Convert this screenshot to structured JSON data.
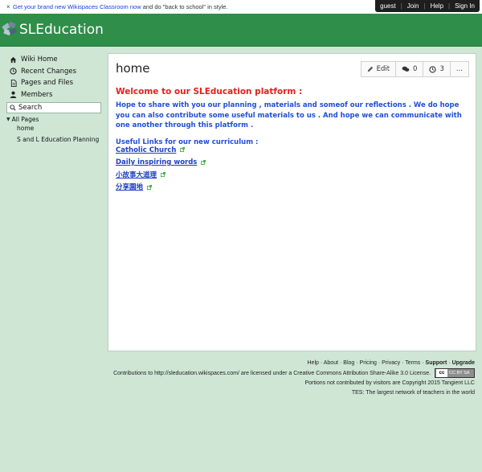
{
  "notice": {
    "close_glyph": "×",
    "link_text": "Get your brand new Wikispaces Classroom now",
    "rest_text": " and do \"back to school\" in style."
  },
  "userbar": {
    "items": [
      "guest",
      "Join",
      "Help",
      "Sign In"
    ]
  },
  "header": {
    "site_title": "SLEducation"
  },
  "sidebar": {
    "items": [
      {
        "label": "Wiki Home",
        "icon": "home-icon"
      },
      {
        "label": "Recent Changes",
        "icon": "clock-icon"
      },
      {
        "label": "Pages and Files",
        "icon": "file-icon"
      },
      {
        "label": "Members",
        "icon": "user-icon"
      }
    ],
    "search_placeholder": "Search",
    "all_pages_label": "All Pages",
    "pages": [
      "home",
      "S and L Education Planning"
    ]
  },
  "main": {
    "page_title": "home",
    "toolbar": {
      "edit_label": "Edit",
      "comments_count": "0",
      "history_count": "3",
      "more_label": "..."
    },
    "welcome": "Welcome to our SLEducation platform :",
    "paragraph": "Hope to share with you our planning , materials and someof our reflections . We do hope you can also contribute some useful materials to us . And hope we can communicate with one another through this platform .",
    "useful_heading": "Useful Links for our new curriculum :",
    "links": [
      "Catholic Church",
      "Daily inspiring words",
      "小故事大道理",
      "分享園地"
    ]
  },
  "footer": {
    "links": [
      "Help",
      "About",
      "Blog",
      "Pricing",
      "Privacy",
      "Terms",
      "Support",
      "Upgrade"
    ],
    "license_text": "Contributions to http://sleducation.wikispaces.com/ are licensed under a Creative Commons Attribution Share-Alike 3.0 License.",
    "cc_badge_text": "CC BY SA",
    "copyright": "Portions not contributed by visitors are Copyright 2015 Tangient LLC",
    "tes": "TES: The largest network of teachers in the world"
  },
  "colors": {
    "background": "#cfe6d5",
    "header_green": "#2f8e4a",
    "welcome_red": "#e4201e",
    "text_blue": "#1f4fd6"
  }
}
